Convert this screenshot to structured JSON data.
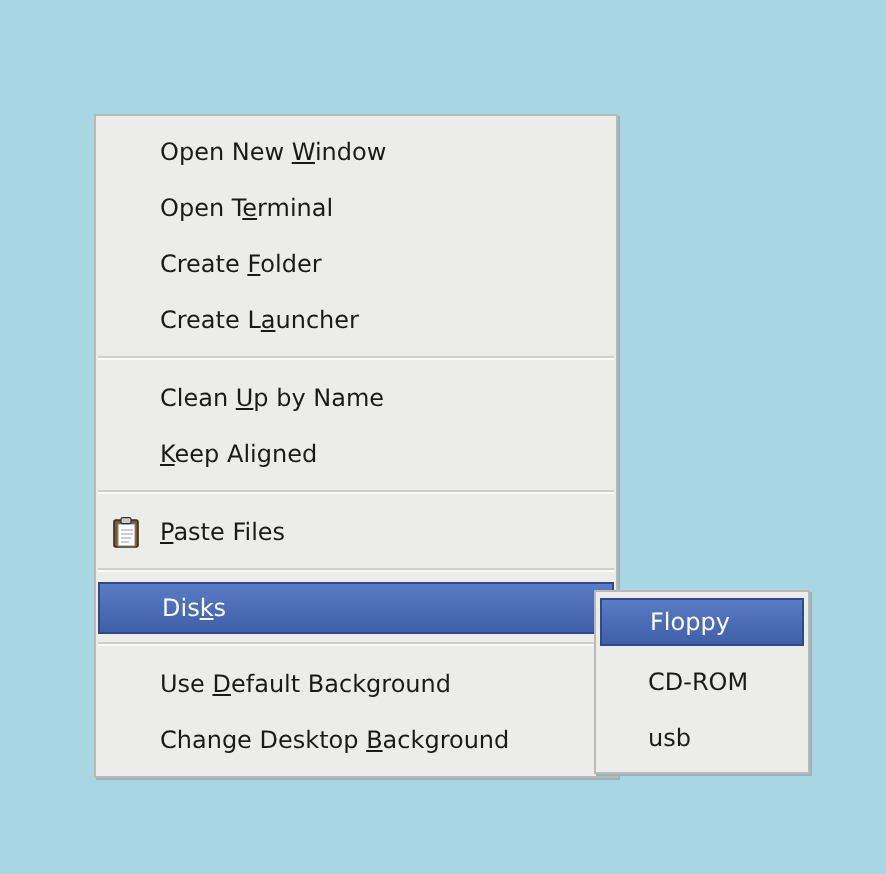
{
  "context_menu": {
    "items": [
      {
        "kind": "item",
        "label": {
          "pre": "Open New ",
          "key": "W",
          "post": "indow"
        },
        "selected": false
      },
      {
        "kind": "item",
        "label": {
          "pre": "Open T",
          "key": "e",
          "post": "rminal"
        },
        "selected": false
      },
      {
        "kind": "item",
        "label": {
          "pre": "Create ",
          "key": "F",
          "post": "older"
        },
        "selected": false
      },
      {
        "kind": "item",
        "label": {
          "pre": "Create L",
          "key": "a",
          "post": "uncher"
        },
        "selected": false
      },
      {
        "kind": "separator"
      },
      {
        "kind": "item",
        "label": {
          "pre": "Clean ",
          "key": "U",
          "post": "p by Name"
        },
        "selected": false
      },
      {
        "kind": "item",
        "label": {
          "key": "K",
          "post": "eep Aligned"
        },
        "selected": false
      },
      {
        "kind": "separator"
      },
      {
        "kind": "icon_item",
        "label": {
          "key": "P",
          "post": "aste Files"
        },
        "selected": false
      },
      {
        "kind": "separator"
      },
      {
        "kind": "item",
        "label": {
          "pre": "Dis",
          "key": "k",
          "post": "s"
        },
        "selected": true
      },
      {
        "kind": "separator"
      },
      {
        "kind": "item",
        "label": {
          "pre": "Use ",
          "key": "D",
          "post": "efault Background"
        },
        "selected": false
      },
      {
        "kind": "item",
        "label": {
          "pre": "Change Desktop ",
          "key": "B",
          "post": "ackground"
        },
        "selected": false
      }
    ]
  },
  "submenu": {
    "items": [
      {
        "label": "Floppy",
        "selected": true
      },
      {
        "label": "CD-ROM",
        "selected": false
      },
      {
        "label": "usb",
        "selected": false
      }
    ]
  }
}
